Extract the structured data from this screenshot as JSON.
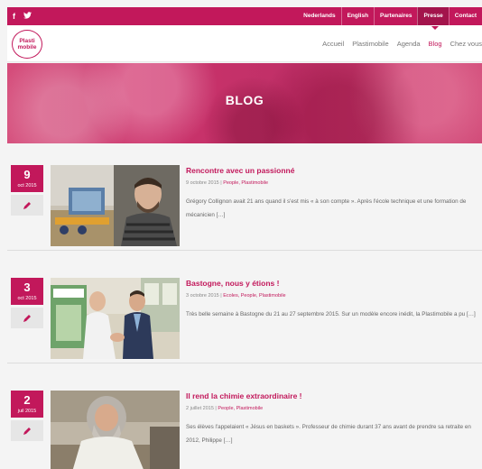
{
  "topbar": {
    "social": [
      {
        "icon": "facebook-icon",
        "glyph": "f"
      },
      {
        "icon": "twitter-icon",
        "glyph": "🐦"
      }
    ],
    "links": [
      {
        "label": "Nederlands"
      },
      {
        "label": "English"
      },
      {
        "label": "Partenaires"
      },
      {
        "label": "Presse"
      },
      {
        "label": "Contact"
      }
    ],
    "active_link": "Presse"
  },
  "header": {
    "logo_line1": "Plasti",
    "logo_line2": "mobile",
    "nav": [
      {
        "label": "Accueil"
      },
      {
        "label": "Plastimobile"
      },
      {
        "label": "Agenda"
      },
      {
        "label": "Blog"
      },
      {
        "label": "Chez vous"
      }
    ],
    "active_nav": "Blog"
  },
  "hero": {
    "title": "BLOG"
  },
  "posts": [
    {
      "day": "9",
      "month": "oct 2015",
      "title": "Rencontre avec un passionné",
      "date": "9 octobre 2015",
      "sep": "|",
      "categories": "People, Plastimobile",
      "excerpt": "Grégory Collignon avait 21 ans quand il s'est mis « à son compte ». Après l'école technique et une formation de mécanicien […]"
    },
    {
      "day": "3",
      "month": "oct 2015",
      "title": "Bastogne, nous y étions !",
      "date": "3 octobre 2015",
      "sep": "|",
      "categories": "Ecoles, People, Plastimobile",
      "excerpt": "Très belle semaine à Bastogne du 21 au 27 septembre 2015. Sur un modèle encore inédit, la Plastimobile a pu […]"
    },
    {
      "day": "2",
      "month": "juil 2015",
      "title": "Il rend la chimie extraordinaire !",
      "date": "2 juillet 2015",
      "sep": "|",
      "categories": "People, Plastimobile",
      "excerpt": "Ses élèves l'appelaient « Jésus en baskets ». Professeur de chimie durant 37 ans avant de prendre sa retraite en 2012, Philippe […]"
    }
  ],
  "colors": {
    "brand": "#c2185b",
    "background": "#f4f4f4"
  }
}
